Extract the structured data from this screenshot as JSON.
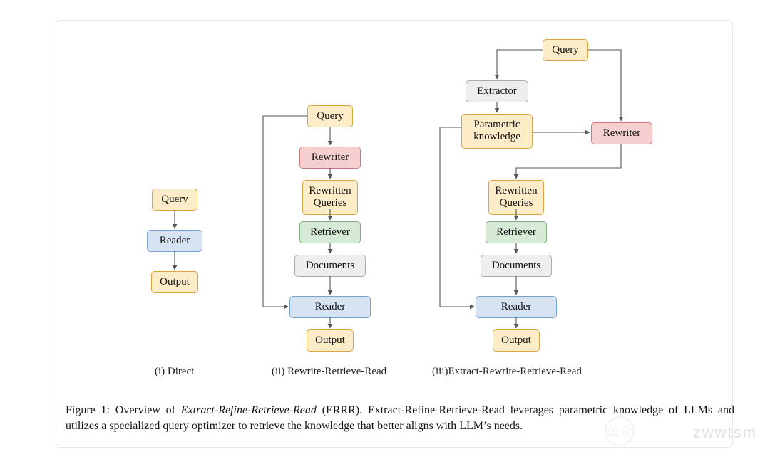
{
  "figure": {
    "col_i": {
      "query": "Query",
      "reader": "Reader",
      "output": "Output",
      "label": "(i) Direct"
    },
    "col_ii": {
      "query": "Query",
      "rewriter": "Rewriter",
      "rewritten": "Rewritten\nQueries",
      "retriever": "Retriever",
      "documents": "Documents",
      "reader": "Reader",
      "output": "Output",
      "label": "(ii) Rewrite-Retrieve-Read"
    },
    "col_iii": {
      "query": "Query",
      "extractor": "Extractor",
      "parametric": "Parametric\nknowledge",
      "rewriter": "Rewriter",
      "rewritten": "Rewritten\nQueries",
      "retriever": "Retriever",
      "documents": "Documents",
      "reader": "Reader",
      "output": "Output",
      "label": "(iii)Extract-Rewrite-Retrieve-Read"
    }
  },
  "caption": {
    "prefix": "Figure 1: Overview of ",
    "emph": "Extract-Refine-Retrieve-Read",
    "abbr": " (ERRR). ",
    "rest": "Extract-Refine-Retrieve-Read leverages parametric knowledge of LLMs and utilizes a specialized query optimizer to retrieve the knowledge that better aligns with LLM’s needs."
  },
  "watermark": {
    "text": "zwwtsm",
    "badge": "公众"
  }
}
